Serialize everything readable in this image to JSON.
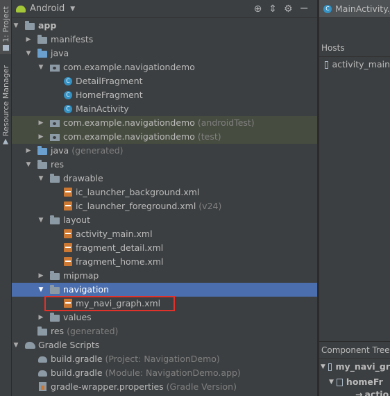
{
  "sidebar": {
    "project_tab": "1: Project",
    "resource_tab": "Resource Manager"
  },
  "toolbar": {
    "view_mode": "Android",
    "icons": [
      "target-icon",
      "collapse-icon",
      "gear-icon",
      "hide-icon"
    ]
  },
  "tree": [
    {
      "label": "app",
      "bold": true
    },
    {
      "label": "manifests"
    },
    {
      "label": "java"
    },
    {
      "label": "com.example.navigationdemo"
    },
    {
      "label": "DetailFragment"
    },
    {
      "label": "HomeFragment"
    },
    {
      "label": "MainActivity"
    },
    {
      "label": "com.example.navigationdemo",
      "suffix": "(androidTest)"
    },
    {
      "label": "com.example.navigationdemo",
      "suffix": "(test)"
    },
    {
      "label": "java",
      "suffix": "(generated)"
    },
    {
      "label": "res"
    },
    {
      "label": "drawable"
    },
    {
      "label": "ic_launcher_background.xml"
    },
    {
      "label": "ic_launcher_foreground.xml",
      "suffix": "(v24)"
    },
    {
      "label": "layout"
    },
    {
      "label": "activity_main.xml"
    },
    {
      "label": "fragment_detail.xml"
    },
    {
      "label": "fragment_home.xml"
    },
    {
      "label": "mipmap"
    },
    {
      "label": "navigation"
    },
    {
      "label": "my_navi_graph.xml"
    },
    {
      "label": "values"
    },
    {
      "label": "res",
      "suffix": "(generated)"
    },
    {
      "label": "Gradle Scripts"
    },
    {
      "label": "build.gradle",
      "suffix": "(Project: NavigationDemo)"
    },
    {
      "label": "build.gradle",
      "suffix": "(Module: NavigationDemo.app)"
    },
    {
      "label": "gradle-wrapper.properties",
      "suffix": "(Gradle Version)"
    }
  ],
  "editor_tab": {
    "label": "MainActivity.j"
  },
  "hosts": {
    "title": "Hosts",
    "item": "activity_main"
  },
  "component_tree": {
    "title": "Component Tree",
    "root": "my_navi_gr",
    "child": "homeFr",
    "leaf": "actio"
  },
  "colors": {
    "selection": "#4b6eaf",
    "highlight_box": "#e0312a",
    "background": "#3c3f41"
  }
}
